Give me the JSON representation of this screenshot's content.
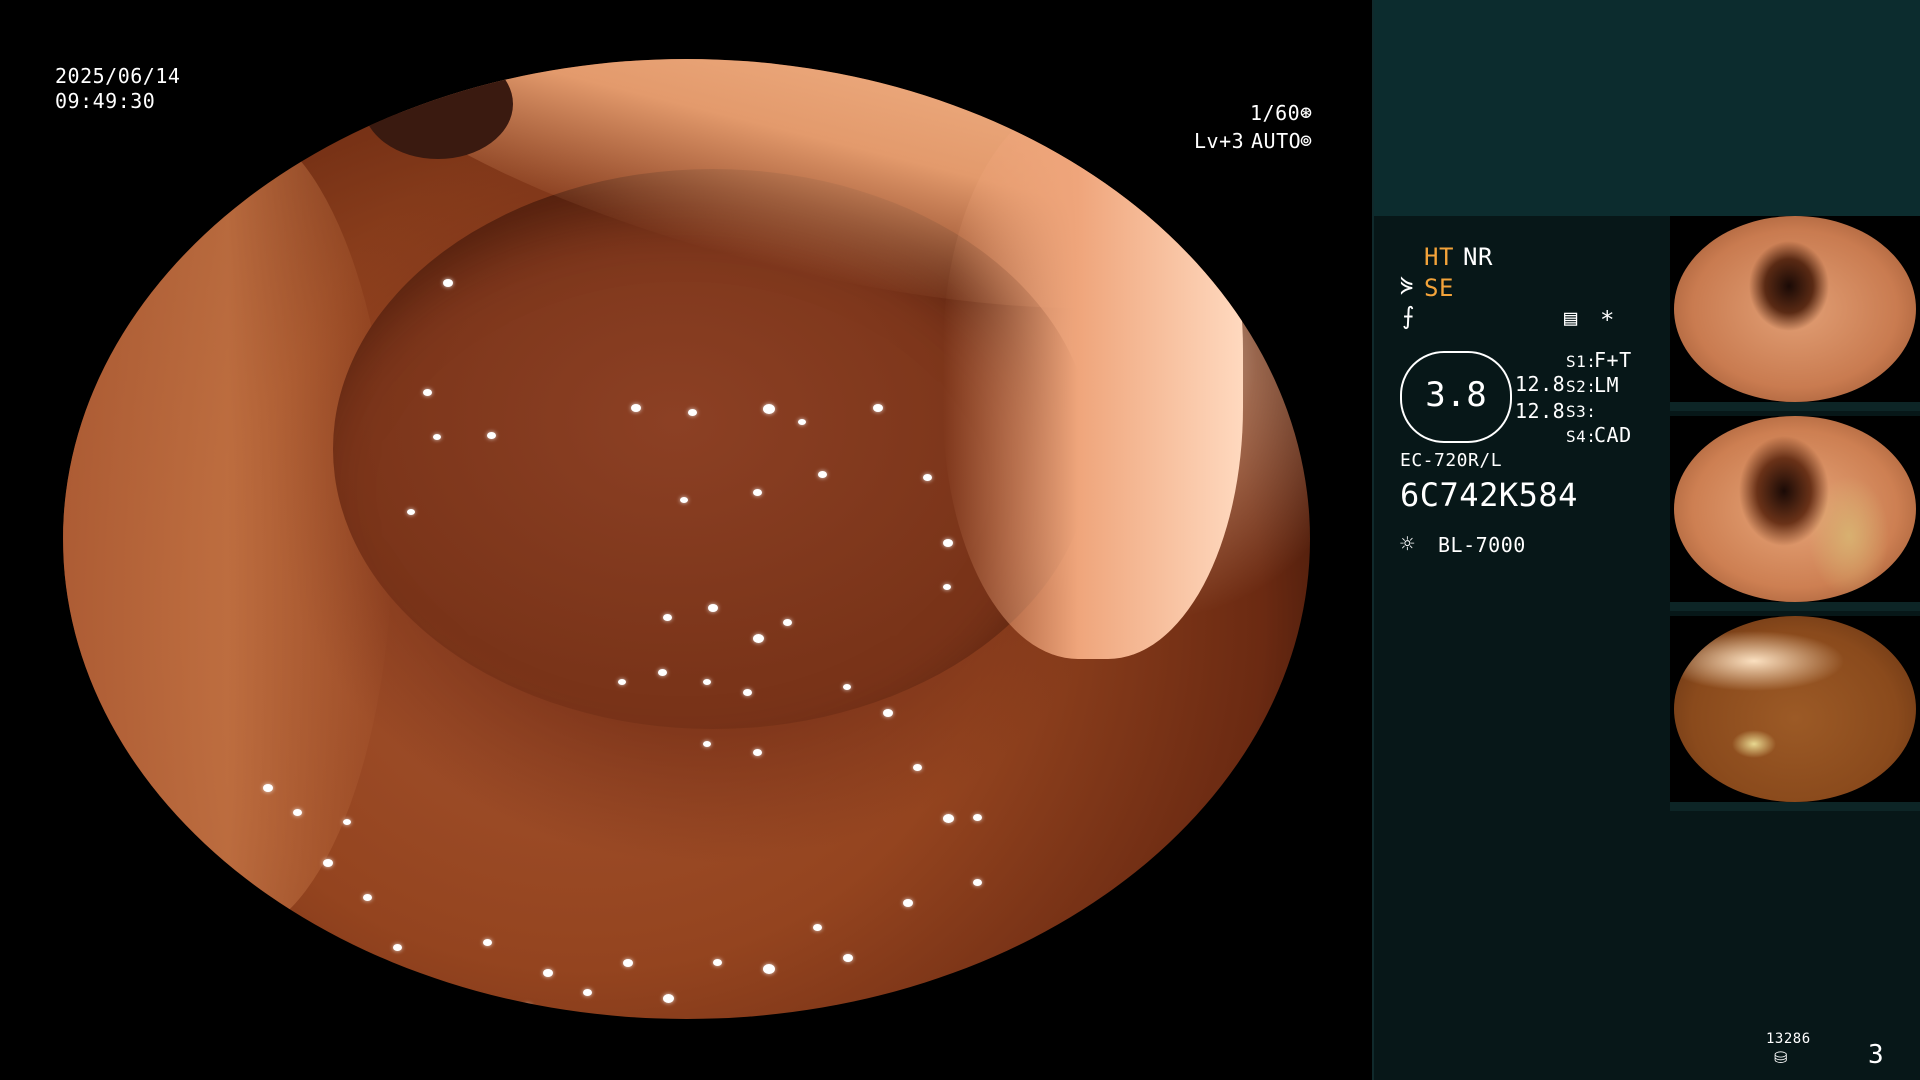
{
  "header": {
    "date": "2025/06/14",
    "time": "09:49:30"
  },
  "video_status": {
    "shutter": "1/60",
    "level": "Lv+3",
    "mode": "AUTO"
  },
  "panel": {
    "ht": "HT",
    "nr": "NR",
    "se": "SE",
    "gauge_value": "3.8",
    "readout_1": "12.8",
    "readout_2": "12.8",
    "s1_label": "S1:",
    "s1_value": "F+T",
    "s2_label": "S2:",
    "s2_value": "LM",
    "s3_label": "S3:",
    "s3_value": "",
    "s4_label": "S4:",
    "s4_value": "CAD",
    "scope_model": "EC-720R/L",
    "serial": "6C742K584",
    "light_source": "BL-7000",
    "asterisk": "*"
  },
  "footer": {
    "storage_count": "13286",
    "image_count": "3"
  },
  "colors": {
    "accent": "#f3a33a",
    "panel_bg": "#071718",
    "panel_top_bg": "#0c2c2e"
  },
  "icons": [
    "shutter-icon",
    "auto-iris-icon",
    "structure-enhance-icon",
    "filter-icon",
    "menu-icon",
    "light-source-icon",
    "storage-icon"
  ],
  "thumbnails": [
    {
      "id": "thumb-1"
    },
    {
      "id": "thumb-2"
    },
    {
      "id": "thumb-3"
    }
  ]
}
